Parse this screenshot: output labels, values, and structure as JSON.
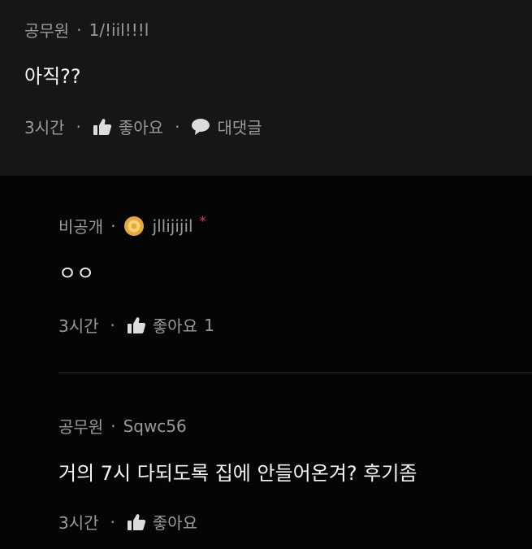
{
  "comments": [
    {
      "author": "공무원",
      "username": "1/!iil!!!l",
      "text": "아직??",
      "time": "3시간",
      "like_label": "좋아요",
      "reply_label": "대댓글"
    },
    {
      "author": "비공개",
      "username": "jllijijil",
      "text": "ㅇㅇ",
      "time": "3시간",
      "like_label": "좋아요",
      "like_count": "1"
    },
    {
      "author": "공무원",
      "username": "Sqwc56",
      "text": "거의 7시 다되도록 집에 안들어온겨? 후기좀",
      "time": "3시간",
      "like_label": "좋아요"
    }
  ],
  "separator": "·",
  "asterisk": "*",
  "colors": {
    "top_background": "#161616",
    "reply_background": "#050505",
    "meta_text": "#9a9a9a",
    "body_text": "#f5f5f5",
    "badge_gold": "#e7a83a",
    "asterisk_red": "#e0405a"
  }
}
